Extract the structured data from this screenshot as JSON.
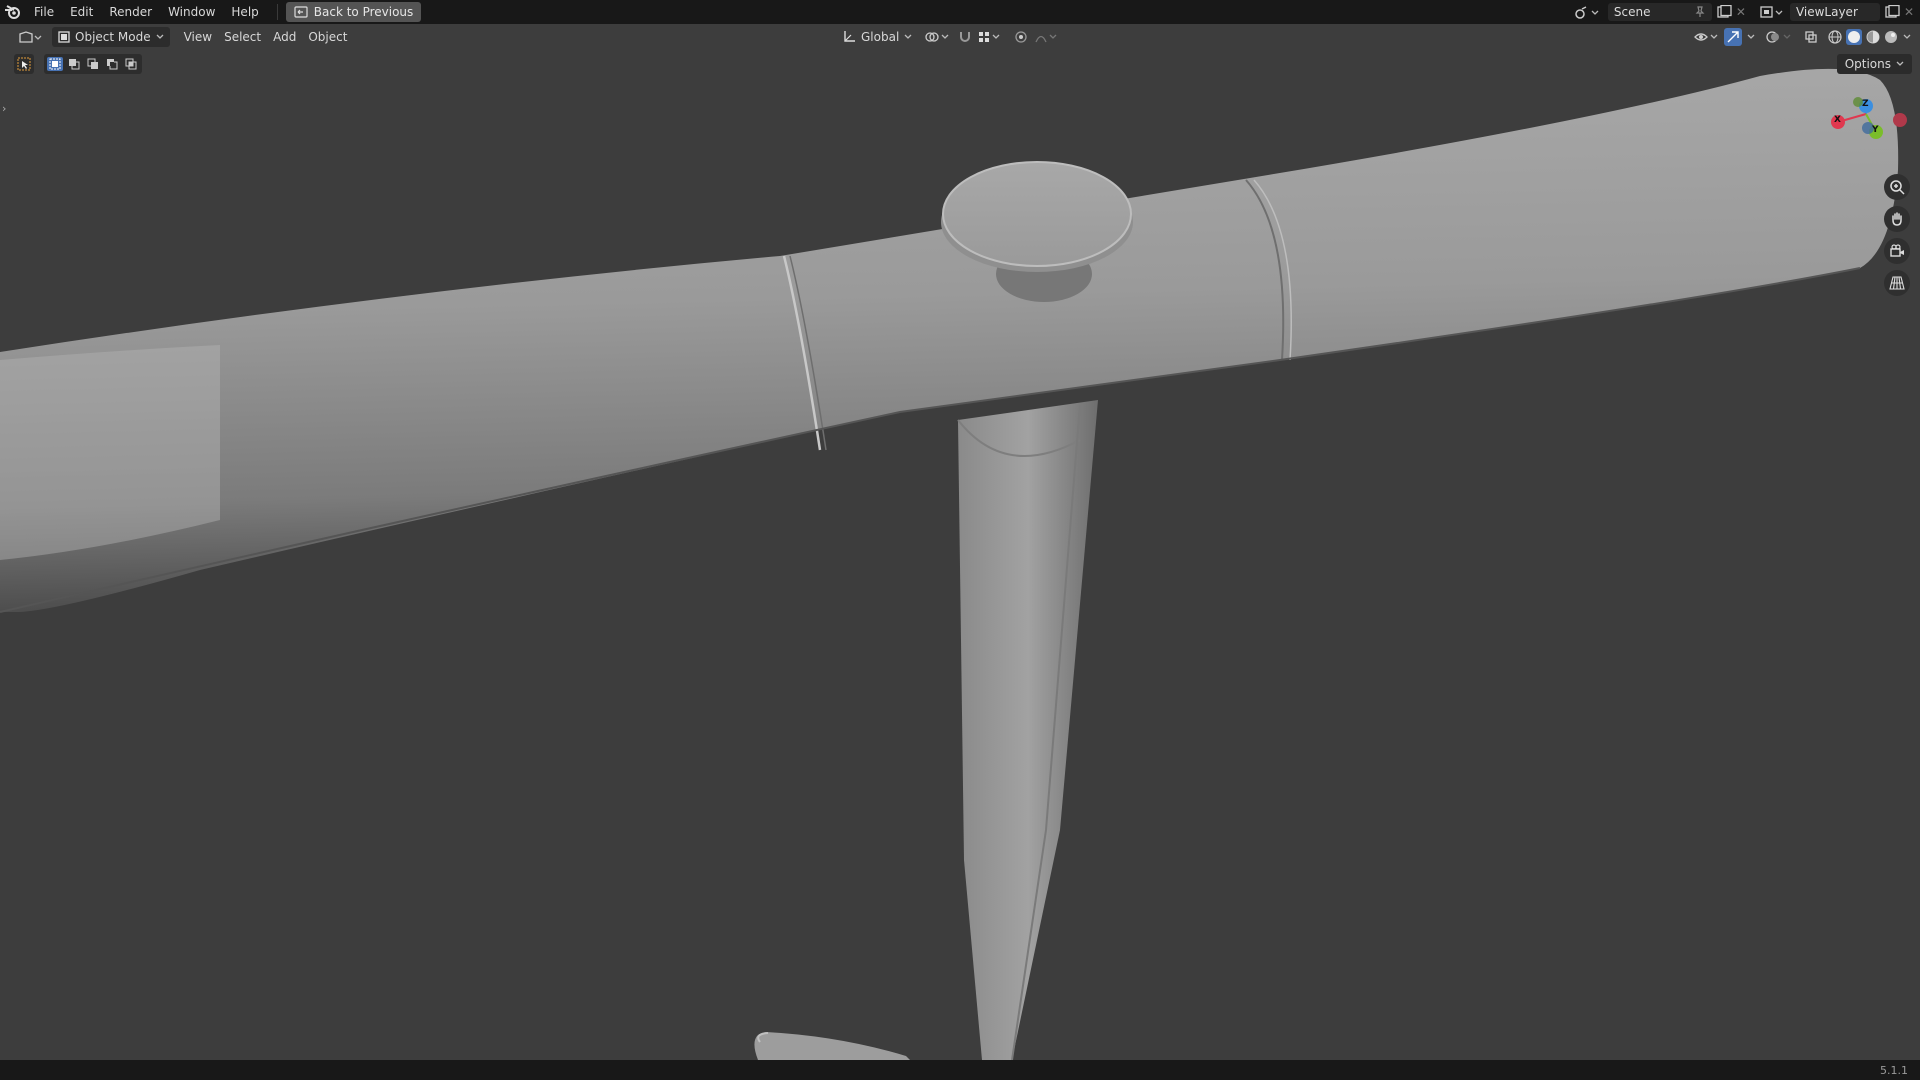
{
  "menubar": {
    "items": [
      "File",
      "Edit",
      "Render",
      "Window",
      "Help"
    ],
    "back_button": "Back to Previous"
  },
  "top_right": {
    "scene_label": "Scene",
    "view_layer_label": "ViewLayer"
  },
  "header": {
    "mode_label": "Object Mode",
    "menu_items": [
      "View",
      "Select",
      "Add",
      "Object"
    ],
    "orientation_label": "Global"
  },
  "options_label": "Options",
  "gizmo": {
    "z_label": "Z",
    "x_label": "X",
    "y_label": "Y"
  },
  "status": {
    "version": "5.1.1"
  },
  "colors": {
    "viewport_bg": "#3d3d3d",
    "topbar_bg": "#181818",
    "axis_x": "#e0384f",
    "axis_y": "#7bbd2a",
    "axis_z": "#3b8fe0",
    "accent": "#4772b3",
    "mesh": "#9c9c9c"
  },
  "icons": {
    "logo": "blender-logo-icon",
    "back": "back-to-previous-icon",
    "zoom": "zoom-icon",
    "pan": "hand-pan-icon",
    "camera": "camera-view-icon",
    "ortho": "perspective-grid-icon"
  }
}
